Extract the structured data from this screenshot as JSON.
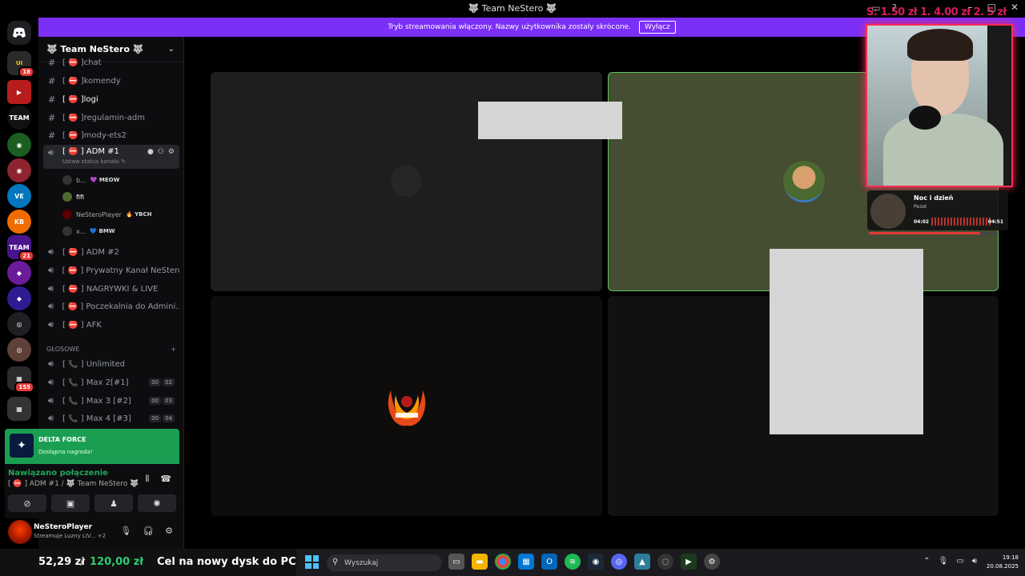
{
  "window": {
    "title": "🐺 Team NeStero 🐺",
    "overlay_text": "S: 1.50 zł 1. 4.00 zł 2. 5 zł"
  },
  "banner": {
    "message": "Tryb streamowania włączony. Nazwy użytkownika zostały skrócone.",
    "button": "Wyłącz"
  },
  "rail": {
    "badges": [
      "18",
      "21",
      "155"
    ]
  },
  "server": {
    "name": "🐺 Team NeStero 🐺"
  },
  "channels": {
    "text": [
      {
        "name": "[ ⛔ ]chat"
      },
      {
        "name": "[ ⛔ ]komendy"
      },
      {
        "name": "[ ⛔ ]logi"
      },
      {
        "name": "[ ⛔ ]regulamin-adm"
      },
      {
        "name": "[ ⛔ ]mody-ets2"
      }
    ],
    "selected_voice": {
      "name": "[ ⛔ ] ADM #1",
      "status": "Ustaw status kanału ✎"
    },
    "members": [
      {
        "name": "b...",
        "tag": "💜 MEOW"
      },
      {
        "name": "fifi",
        "tag": ""
      },
      {
        "name": "NeSteroPlayer",
        "tag": "🔥 YBCH"
      },
      {
        "name": "x...",
        "tag": "💙 BMW"
      }
    ],
    "voice": [
      {
        "name": "[ ⛔ ] ADM #2"
      },
      {
        "name": "[ ⛔ ] Prywatny Kanał NeStero"
      },
      {
        "name": "[ ⛔ ] NAGRYWKI & LIVE"
      },
      {
        "name": "[ ⛔ ] Poczekalnia do Admini..."
      },
      {
        "name": "[ ⛔ ] AFK"
      }
    ],
    "category": "GŁOSOWE",
    "public_voice": [
      {
        "name": "[ 📞 ] Unlimited",
        "c1": "",
        "c2": ""
      },
      {
        "name": "[ 📞 ] Max 2[#1]",
        "c1": "00",
        "c2": "02"
      },
      {
        "name": "[ 📞 ] Max 3 [#2]",
        "c1": "00",
        "c2": "03"
      },
      {
        "name": "[ 📞 ] Max 4 [#3]",
        "c1": "00",
        "c2": "04"
      }
    ]
  },
  "promo": {
    "title": "DELTA FORCE",
    "subtitle": "Dostępna nagroda!"
  },
  "voice_status": {
    "connected": "Nawiązano połączenie",
    "channel": "[ ⛔ ] ADM #1 / 🐺 Team NeStero 🐺"
  },
  "user": {
    "name": "NeSteroPlayer",
    "status": "Streamuje Luzny LIV...",
    "extra": "+2"
  },
  "music": {
    "title": "Noc i dzień",
    "artist": "Pezet",
    "elapsed": "04:02",
    "total": "04:51",
    "progress": 0.87
  },
  "taskbar": {
    "amount": "52,29 zł",
    "separator": "/",
    "goal": "120,00 zł",
    "goal_label": "Cel na nowy dysk do PC",
    "search_placeholder": "Wyszukaj",
    "time": "19:18",
    "date": "20.08.2025"
  }
}
